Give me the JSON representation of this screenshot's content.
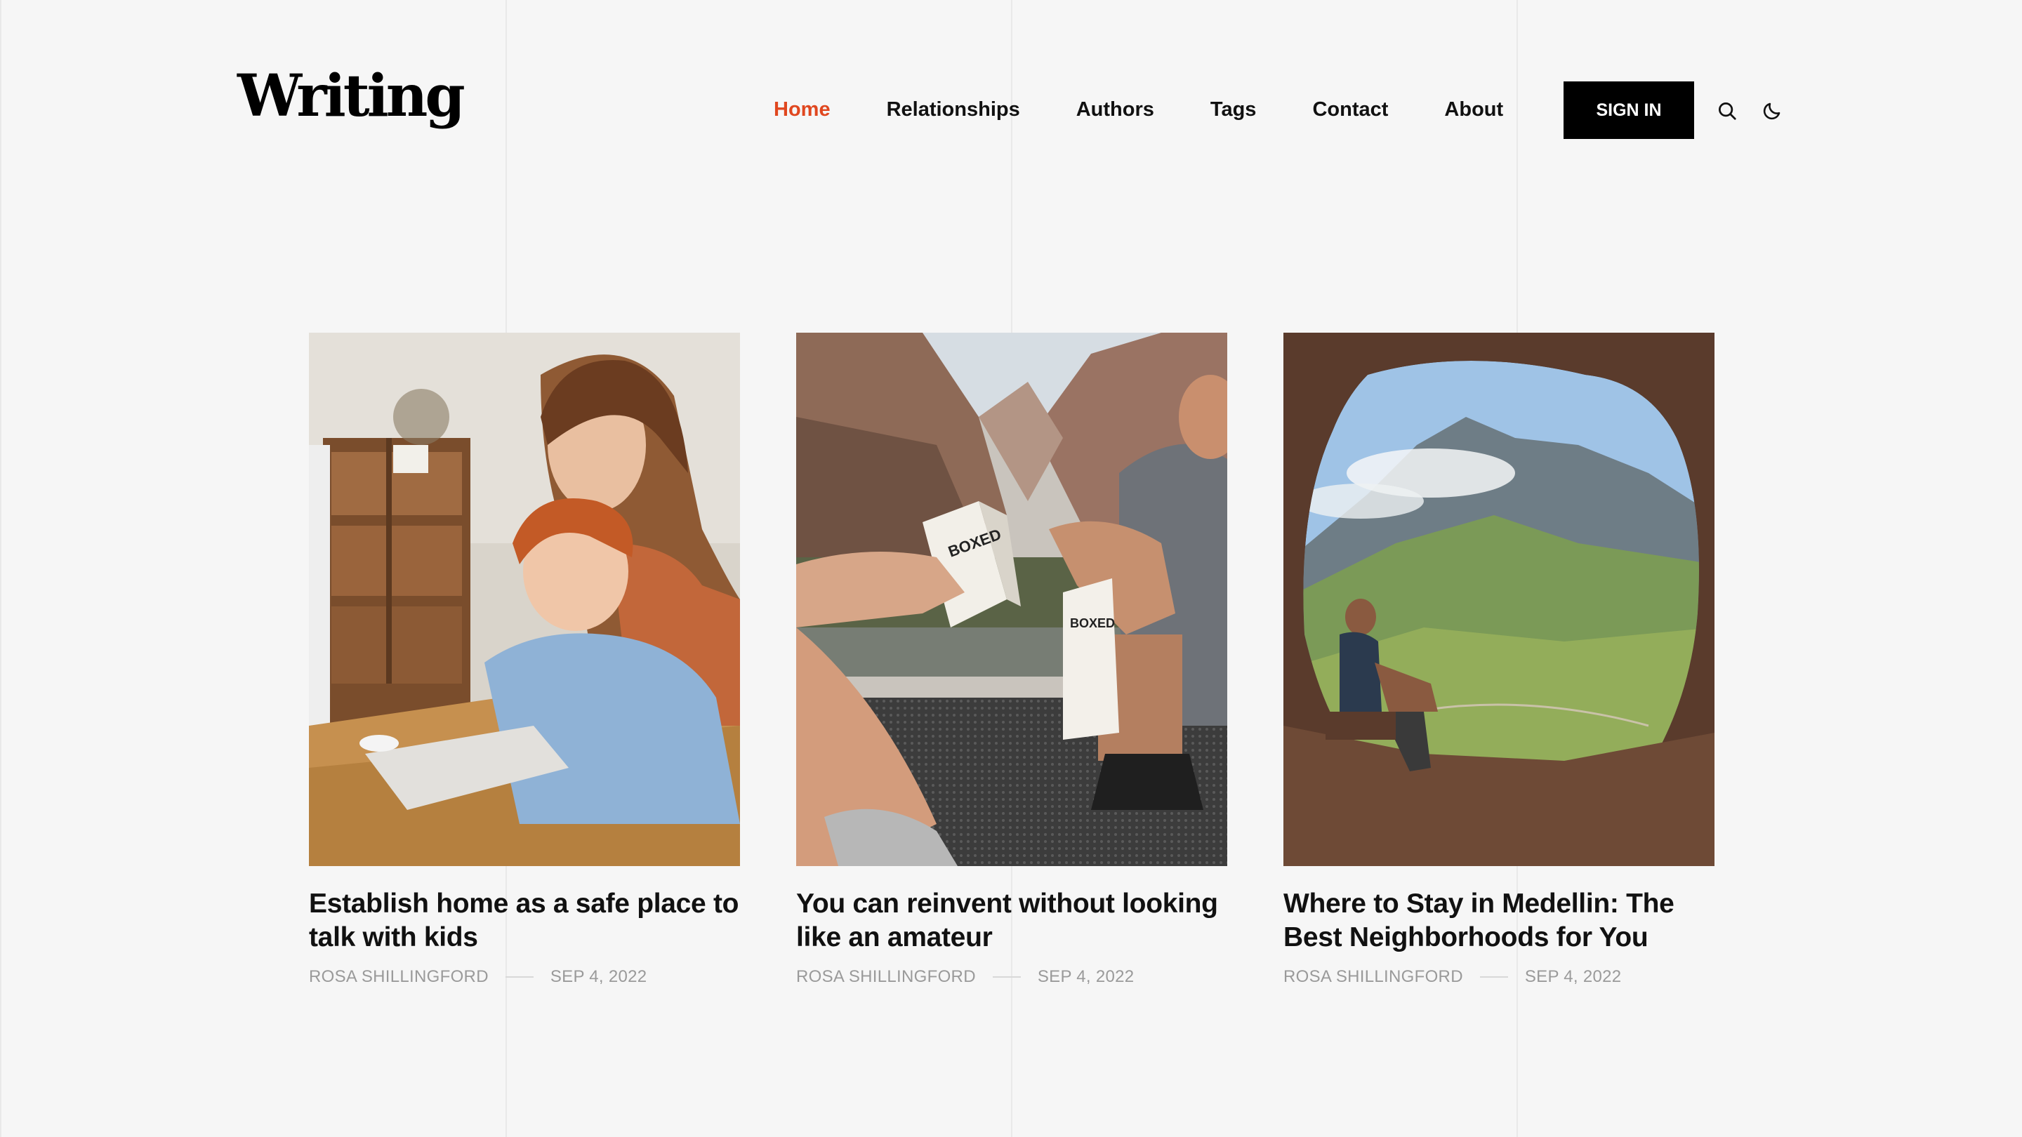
{
  "brand": {
    "logo_text": "Writing"
  },
  "nav": {
    "items": [
      {
        "label": "Home",
        "active": true
      },
      {
        "label": "Relationships"
      },
      {
        "label": "Authors"
      },
      {
        "label": "Tags"
      },
      {
        "label": "Contact"
      },
      {
        "label": "About"
      }
    ],
    "signin_label": "SIGN IN",
    "search_icon": "search-icon",
    "theme_icon": "moon-icon",
    "active_color": "#e0471f"
  },
  "posts": [
    {
      "title": "Establish home as a safe place to talk with kids",
      "author": "ROSA SHILLINGFORD",
      "date": "SEP 4, 2022",
      "image": "mother and son using a computer at a wooden desk"
    },
    {
      "title": "You can reinvent without looking like an amateur",
      "author": "ROSA SHILLINGFORD",
      "date": "SEP 4, 2022",
      "image": "two people holding boxed water cartons in a canyon"
    },
    {
      "title": "Where to Stay in Medellin: The Best Neighborhoods for You",
      "author": "ROSA SHILLINGFORD",
      "date": "SEP 4, 2022",
      "image": "hiker sitting in a cave opening overlooking a mountain"
    }
  ]
}
